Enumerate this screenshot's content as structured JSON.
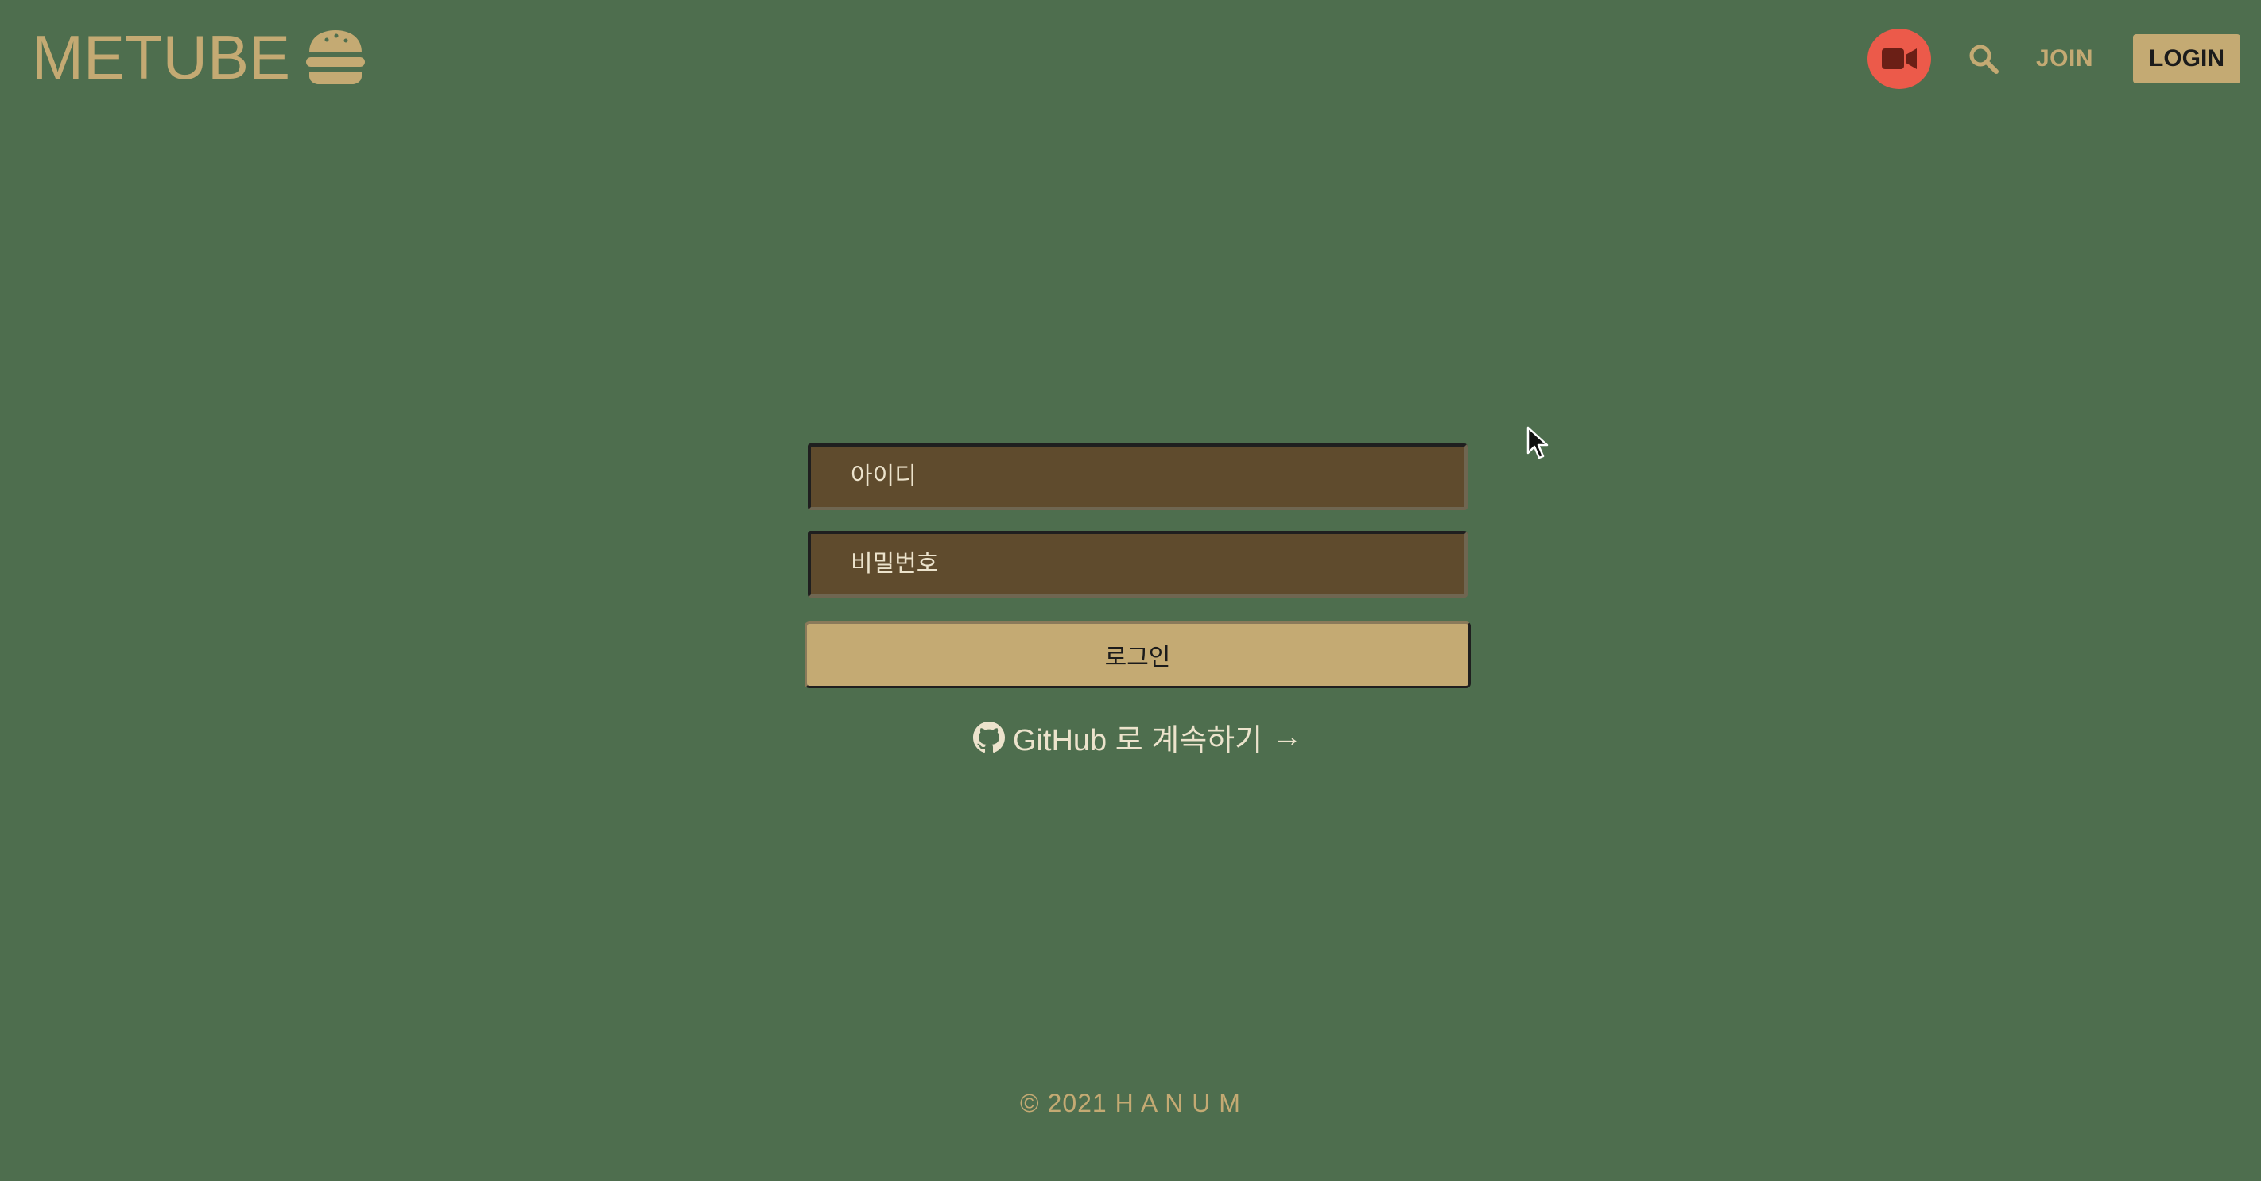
{
  "header": {
    "logo_text": "METUBE",
    "logo_icon": "hamburger-icon",
    "upload_icon": "video-camera-icon",
    "search_icon": "search-icon",
    "join_label": "JOIN",
    "login_label": "LOGIN"
  },
  "login_form": {
    "username_placeholder": "아이디",
    "password_placeholder": "비밀번호",
    "submit_label": "로그인",
    "github_icon": "github-icon",
    "github_label": "GitHub 로 계속하기",
    "github_arrow": "→"
  },
  "footer": {
    "text": "© 2021 H A N U M"
  },
  "colors": {
    "background": "#4e6e4e",
    "accent": "#c4aa73",
    "input_background": "#5f4b2d",
    "upload_button": "#ec5a4a"
  }
}
